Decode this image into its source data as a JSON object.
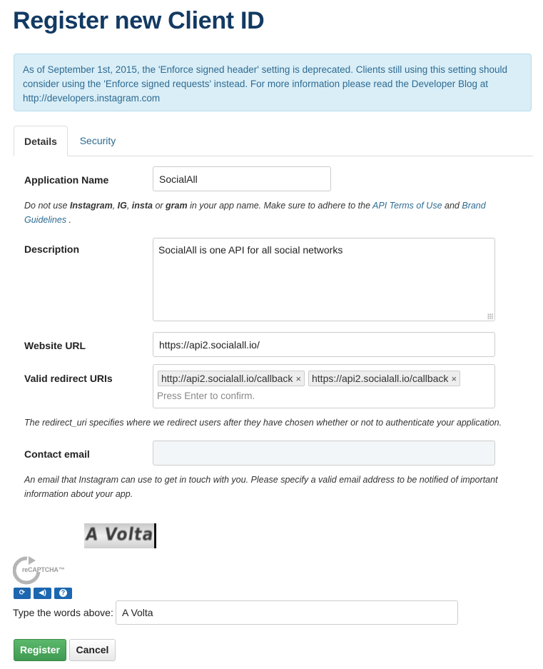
{
  "page": {
    "title": "Register new Client ID"
  },
  "alert": {
    "text": "As of September 1st, 2015, the 'Enforce signed header' setting is deprecated. Clients still using this setting should consider using the 'Enforce signed requests' instead. For more information please read the Developer Blog at http://developers.instagram.com"
  },
  "tabs": [
    {
      "label": "Details",
      "active": true
    },
    {
      "label": "Security",
      "active": false
    }
  ],
  "form": {
    "app_name": {
      "label": "Application Name",
      "value": "SocialAll"
    },
    "app_name_help": {
      "part1": "Do not use ",
      "word1": "Instagram",
      "sep1": ", ",
      "word2": "IG",
      "sep2": ", ",
      "word3": "insta",
      "sep3": " or ",
      "word4": "gram",
      "part2": " in your app name. Make sure to adhere to the ",
      "link1": "API Terms of Use",
      "part3": " and ",
      "link2": "Brand Guidelines",
      "part4": " ."
    },
    "description": {
      "label": "Description",
      "value": "SocialAll is one API for all social networks"
    },
    "website": {
      "label": "Website URL",
      "value": "https://api2.socialall.io/"
    },
    "redirect": {
      "label": "Valid redirect URIs",
      "tags": [
        "http://api2.socialall.io/callback",
        "https://api2.socialall.io/callback"
      ],
      "remove_glyph": "×",
      "placeholder": "Press Enter to confirm.",
      "help": "The redirect_uri specifies where we redirect users after they have chosen whether or not to authenticate your application."
    },
    "email": {
      "label": "Contact email",
      "value": "",
      "help_line1": "An email that Instagram can use to get in touch with you. Please specify a valid email address to be notified of important",
      "help_line2": "information about your app."
    }
  },
  "captcha": {
    "image_text": "A Volta",
    "logo_text": "reCAPTCHA™",
    "buttons": [
      {
        "icon": "refresh-icon",
        "glyph": "⟳"
      },
      {
        "icon": "audio-icon",
        "glyph": "◀)"
      },
      {
        "icon": "help-icon",
        "glyph": "?"
      }
    ],
    "prompt_label": "Type the words above:",
    "response_value": "A Volta"
  },
  "actions": {
    "register_label": "Register",
    "cancel_label": "Cancel"
  },
  "colors": {
    "title": "#123a63",
    "alert_bg": "#d9eef7",
    "link": "#2e6b92",
    "register_button": "#4aa85c",
    "captcha_button": "#1c67b0"
  }
}
